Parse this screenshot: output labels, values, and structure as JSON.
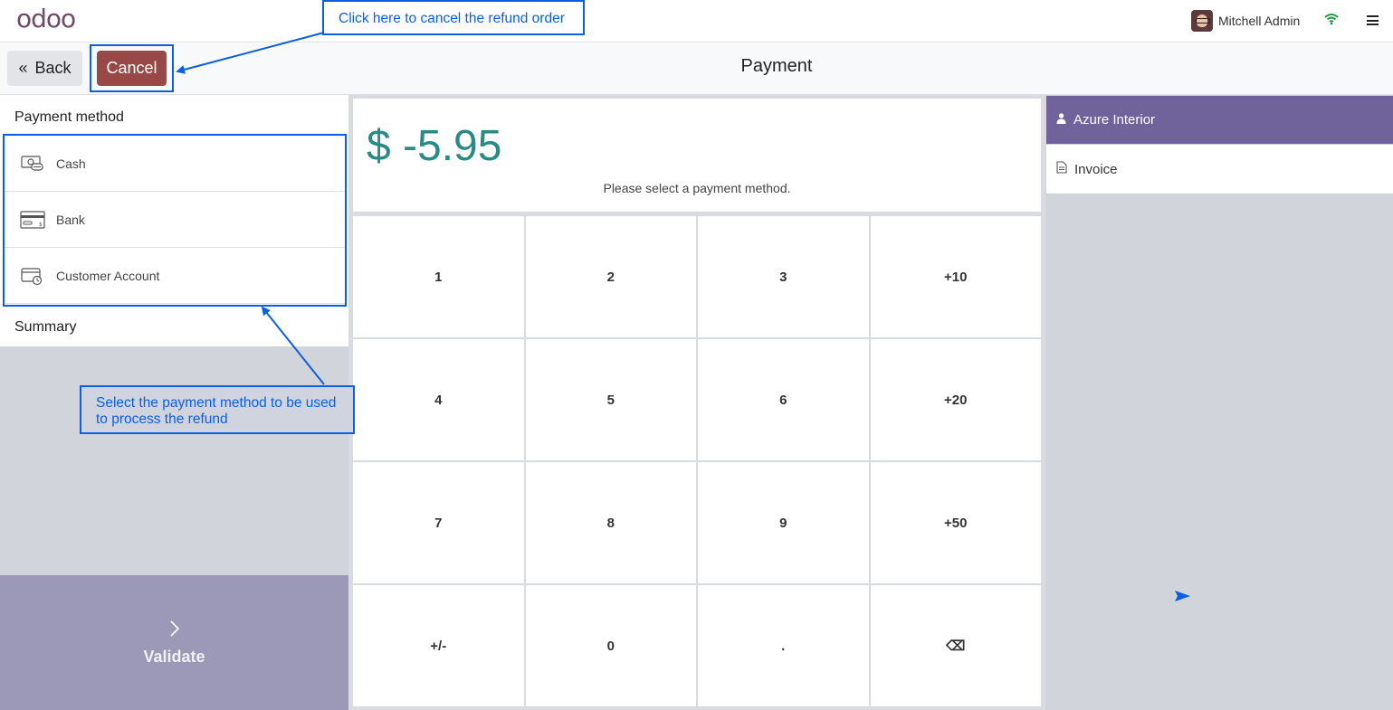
{
  "topbar": {
    "logo": "odoo",
    "user_name": "Mitchell Admin",
    "icons": {
      "avatar": "user-avatar",
      "wifi": "wifi-icon",
      "menu": "hamburger-icon"
    }
  },
  "controls": {
    "back_label": "Back",
    "cancel_label": "Cancel",
    "title": "Payment"
  },
  "payment": {
    "section_title": "Payment method",
    "methods": [
      {
        "label": "Cash",
        "icon": "cash-icon"
      },
      {
        "label": "Bank",
        "icon": "bank-card-icon"
      },
      {
        "label": "Customer Account",
        "icon": "customer-account-icon"
      }
    ],
    "summary_title": "Summary",
    "validate_label": "Validate"
  },
  "amount": {
    "value": "$ -5.95",
    "hint": "Please select a payment method."
  },
  "numpad": {
    "keys": [
      "1",
      "2",
      "3",
      "+10",
      "4",
      "5",
      "6",
      "+20",
      "7",
      "8",
      "9",
      "+50",
      "+/-",
      "0",
      ".",
      "⌫"
    ]
  },
  "customer": {
    "name": "Azure Interior",
    "invoice_label": "Invoice"
  },
  "annotations": {
    "cancel_tip": "Click here to cancel the refund order",
    "method_tip_line1": "Select the payment method to be used",
    "method_tip_line2": "to process the refund"
  },
  "colors": {
    "accent": "#0b5fe3",
    "cancel": "#984947",
    "customer": "#70629b",
    "amount": "#2a8a84",
    "validate": "#9c98b8"
  }
}
